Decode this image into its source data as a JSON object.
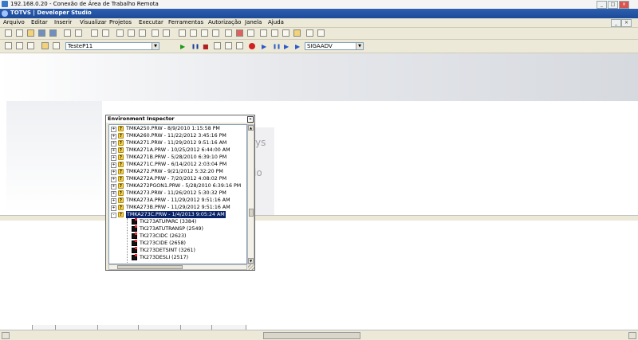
{
  "rdp": {
    "title": "192.168.0.20 - Conexão de Área de Trabalho Remota"
  },
  "app": {
    "title": "TOTVS | Developer Studio"
  },
  "menu": [
    "Arquivo",
    "Editar",
    "Inserir",
    "Visualizar",
    "Projetos",
    "Executar",
    "Ferramentas",
    "Autorização",
    "Janela",
    "Ajuda"
  ],
  "toolbar2": {
    "project_combo": "TesteP11",
    "env_combo": "SIGAADV"
  },
  "inspector": {
    "title": "Environment Inspector",
    "close": "×",
    "items": [
      {
        "label": "TMKA250.PRW - 8/9/2010 1:15:58 PM",
        "expand": "+"
      },
      {
        "label": "TMKA260.PRW - 11/22/2012 3:45:16 PM",
        "expand": "+"
      },
      {
        "label": "TMKA271.PRW - 11/29/2012 9:51:16 AM",
        "expand": "+"
      },
      {
        "label": "TMKA271A.PRW - 10/25/2012 6:44:00 AM",
        "expand": "+"
      },
      {
        "label": "TMKA271B.PRW - 5/28/2010 6:39:10 PM",
        "expand": "+"
      },
      {
        "label": "TMKA271C.PRW - 6/14/2012 2:03:04 PM",
        "expand": "+"
      },
      {
        "label": "TMKA272.PRW - 9/21/2012 5:32:20 PM",
        "expand": "+"
      },
      {
        "label": "TMKA272A.PRW - 7/20/2012 4:08:02 PM",
        "expand": "+"
      },
      {
        "label": "TMKA272PGON1.PRW - 5/28/2010 6:39:16 PM",
        "expand": "+"
      },
      {
        "label": "TMKA273.PRW - 11/26/2012 5:30:32 PM",
        "expand": "+"
      },
      {
        "label": "TMKA273A.PRW - 11/29/2012 9:51:16 AM",
        "expand": "+"
      },
      {
        "label": "TMKA273B.PRW - 11/29/2012 9:51:16 AM",
        "expand": "+"
      },
      {
        "label": "TMKA273C.PRW - 1/4/2013 9:05:24 AM",
        "expand": "-",
        "selected": true
      }
    ],
    "children": [
      "TK273ATUPARC (3384)",
      "TK273ATUTRANSP (2549)",
      "TK273CIDC (2623)",
      "TK273CIDE (2658)",
      "TK273DETSINT (3261)",
      "TK273DESLI (2517)"
    ],
    "question_glyph": "?"
  },
  "ghost": {
    "line1": "ys",
    "line2": "io"
  },
  "controls": {
    "min": "_",
    "max": "□",
    "close": "×"
  }
}
